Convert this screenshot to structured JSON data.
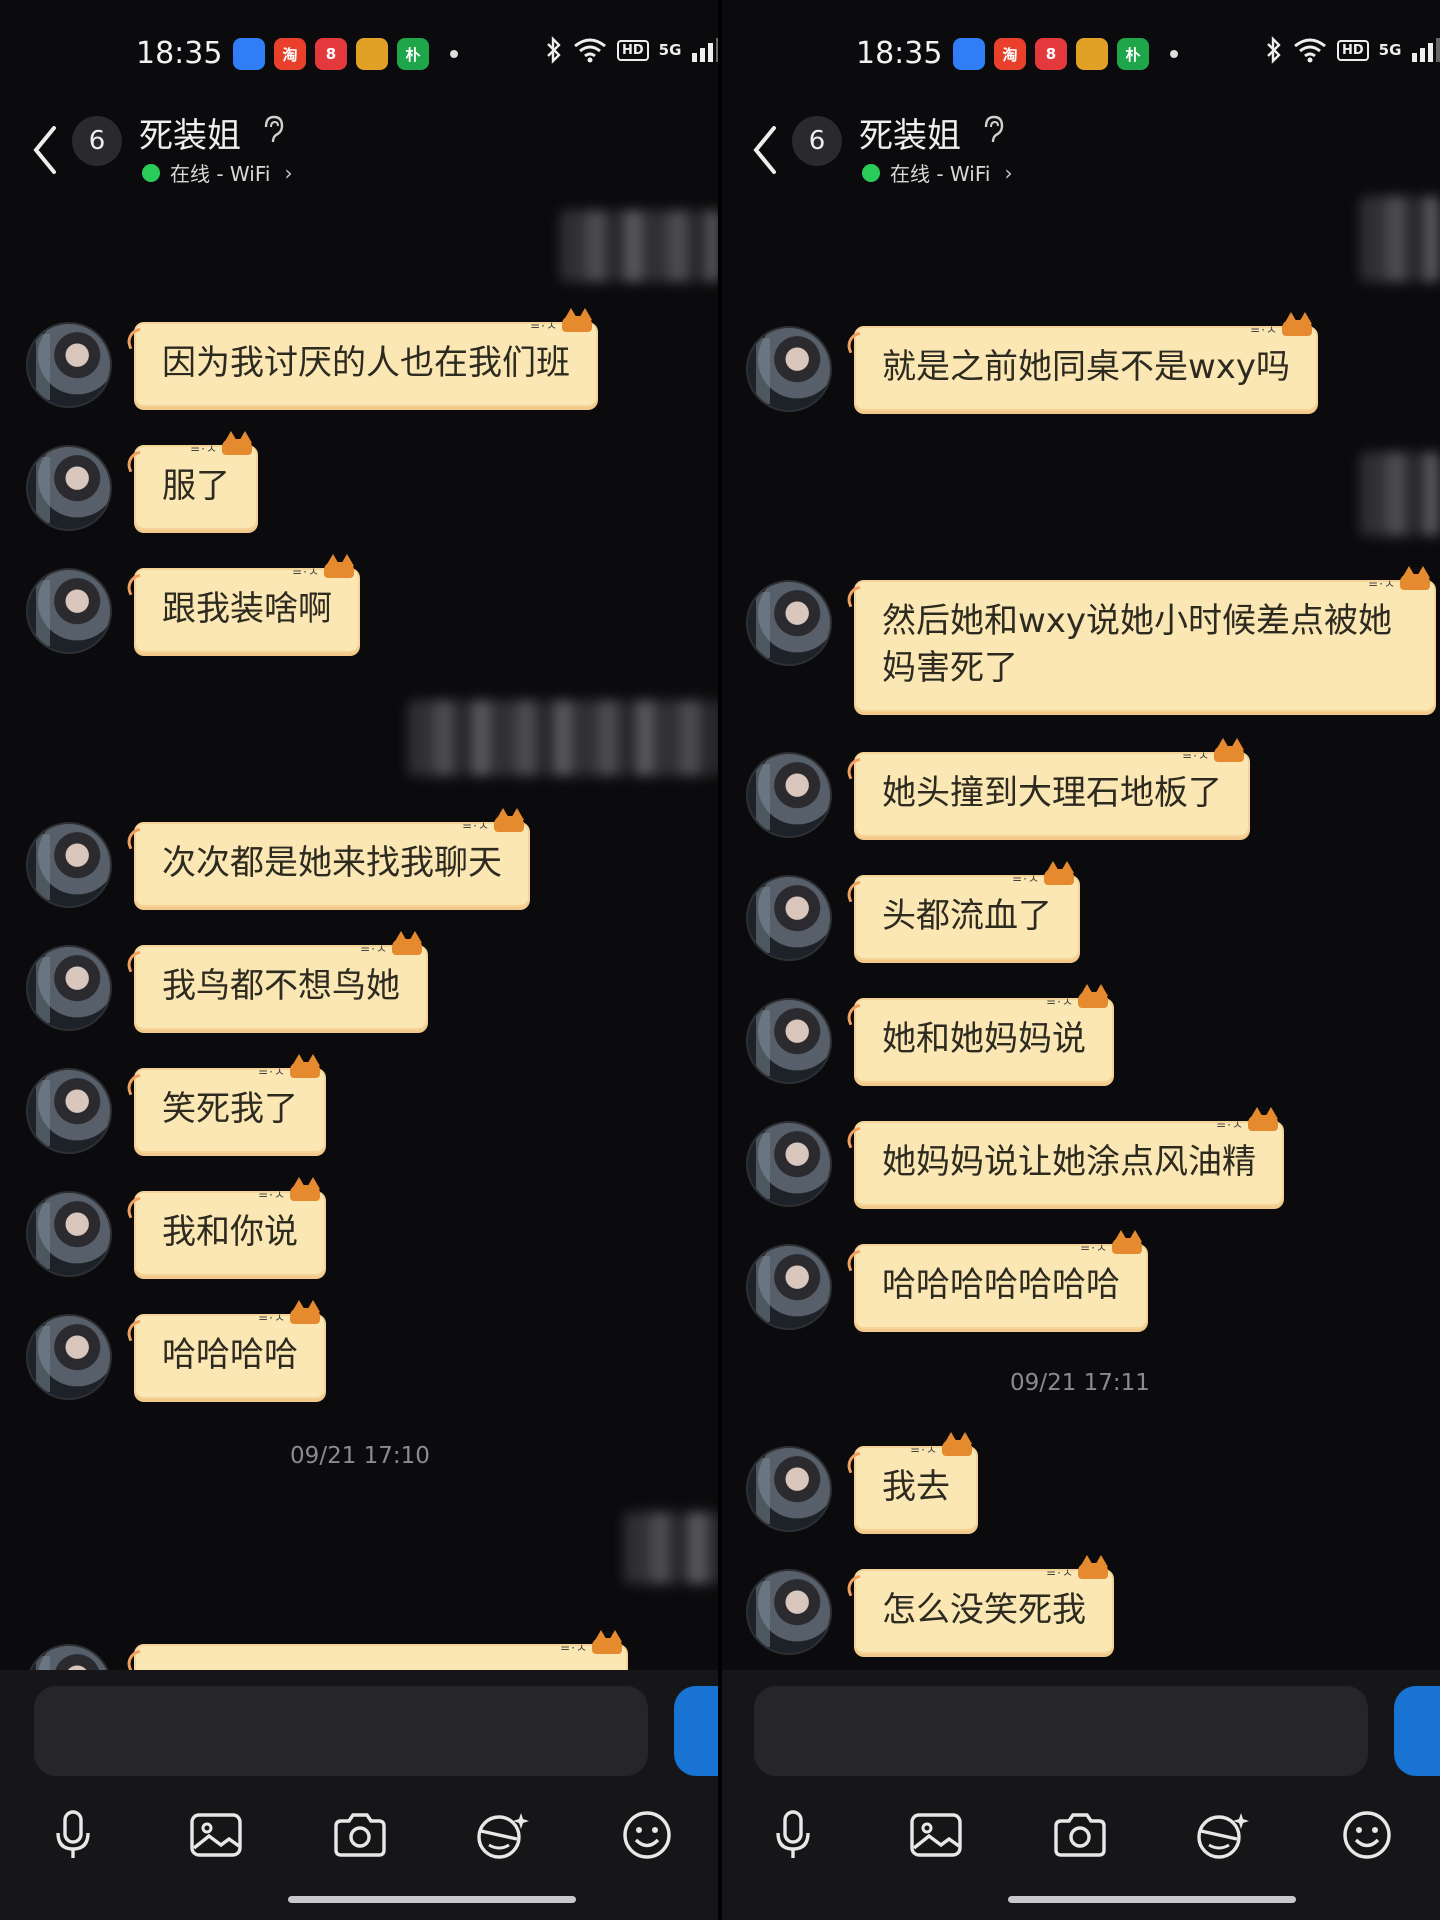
{
  "status": {
    "time": "18:35",
    "app_icons": [
      {
        "name": "app-blue-icon",
        "label": "",
        "color": "#2f7ef5"
      },
      {
        "name": "taobao-icon",
        "label": "淘",
        "color": "#e8402a"
      },
      {
        "name": "pinduoduo-icon",
        "label": "8",
        "color": "#e4393c"
      },
      {
        "name": "app-yellow-icon",
        "label": "",
        "color": "#e0a126"
      },
      {
        "name": "app-green-icon",
        "label": "朴",
        "color": "#1fa64a"
      }
    ],
    "network": "5G",
    "hd": "HD"
  },
  "header": {
    "unread_count": "6",
    "contact_name": "死装姐",
    "online_status": "在线 - WiFi",
    "chevron": "›"
  },
  "left_panel": {
    "messages": [
      {
        "text": "因为我讨厌的人也在我们班"
      },
      {
        "text": "服了"
      },
      {
        "text": "跟我装啥啊"
      },
      {
        "text": "次次都是她来找我聊天"
      },
      {
        "text": "我鸟都不想鸟她"
      },
      {
        "text": "笑死我了"
      },
      {
        "text": "我和你说"
      },
      {
        "text": "哈哈哈哈"
      }
    ],
    "timestamp": "09/21 17:10"
  },
  "right_panel": {
    "messages": [
      {
        "text": "就是之前她同桌不是wxy吗"
      },
      {
        "text": "然后她和wxy说她小时候差点被她妈害死了"
      },
      {
        "text": "她头撞到大理石地板了"
      },
      {
        "text": "头都流血了"
      },
      {
        "text": "她和她妈妈说"
      },
      {
        "text": "她妈妈说让她涂点风油精"
      },
      {
        "text": "哈哈哈哈哈哈哈"
      }
    ],
    "timestamp": "09/21 17:11",
    "messages_after": [
      {
        "text": "我去"
      },
      {
        "text": "怎么没笑死我"
      }
    ]
  },
  "toolbar": {
    "icons": [
      "microphone-icon",
      "image-icon",
      "camera-icon",
      "sticker-icon",
      "emoji-icon"
    ]
  },
  "colors": {
    "background": "#0b0b0d",
    "bubble": "#fbe7b4",
    "accent": "#1873d3",
    "online": "#2bcb5a"
  }
}
